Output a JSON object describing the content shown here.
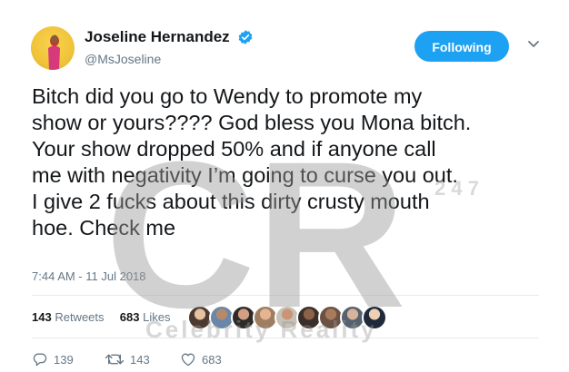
{
  "author": {
    "display_name": "Joseline Hernandez",
    "handle": "@MsJoseline",
    "verified": true,
    "avatar_icon": "user-avatar"
  },
  "follow_button": {
    "label": "Following"
  },
  "tweet": {
    "text": "Bitch did you go to Wendy to promote my\nshow or yours???? God bless you Mona bitch.\nYour show dropped 50% and if anyone call\nme with negativity I’m going to curse you out.\nI give 2 fucks about this dirty crusty mouth\nhoe. Check me",
    "timestamp": "7:44 AM - 11 Jul 2018"
  },
  "stats": {
    "retweets_count": "143",
    "retweets_label": "Retweets",
    "likes_count": "683",
    "likes_label": "Likes"
  },
  "actions": {
    "reply_count": "139",
    "retweet_count": "143",
    "like_count": "683"
  },
  "watermark": {
    "text": "CR",
    "subtext": "Celebrity Reality",
    "digits": "2 4 7"
  },
  "colors": {
    "accent": "#1da1f2",
    "text_primary": "#14171a",
    "text_secondary": "#657786",
    "divider": "#e6ecf0"
  }
}
